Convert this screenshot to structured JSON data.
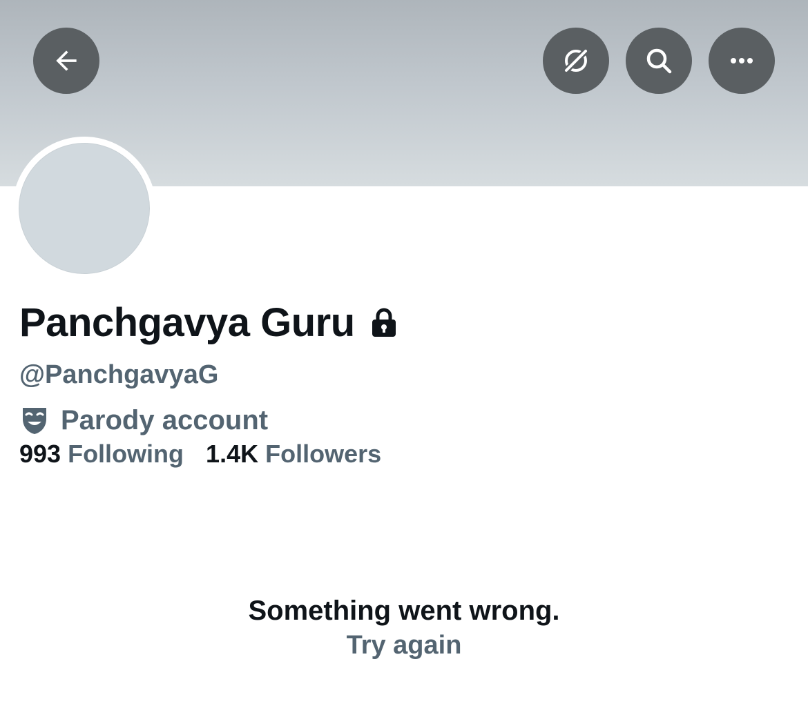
{
  "header": {
    "buttons": {
      "back": "back-arrow-icon",
      "translate": "translate-icon",
      "search": "search-icon",
      "more": "more-icon"
    }
  },
  "profile": {
    "display_name": "Panchgavya Guru",
    "protected": true,
    "handle": "@PanchgavyaG",
    "parody_label": "Parody account",
    "stats": {
      "following_count": "993",
      "following_label": "Following",
      "followers_count": "1.4K",
      "followers_label": "Followers"
    }
  },
  "error": {
    "message": "Something went wrong.",
    "retry_label": "Try again"
  },
  "colors": {
    "primary_text": "#0f1419",
    "secondary_text": "#536471",
    "banner": "#c0c7cd",
    "avatar_placeholder": "#d1d9de",
    "header_button": "#5a5f62"
  }
}
